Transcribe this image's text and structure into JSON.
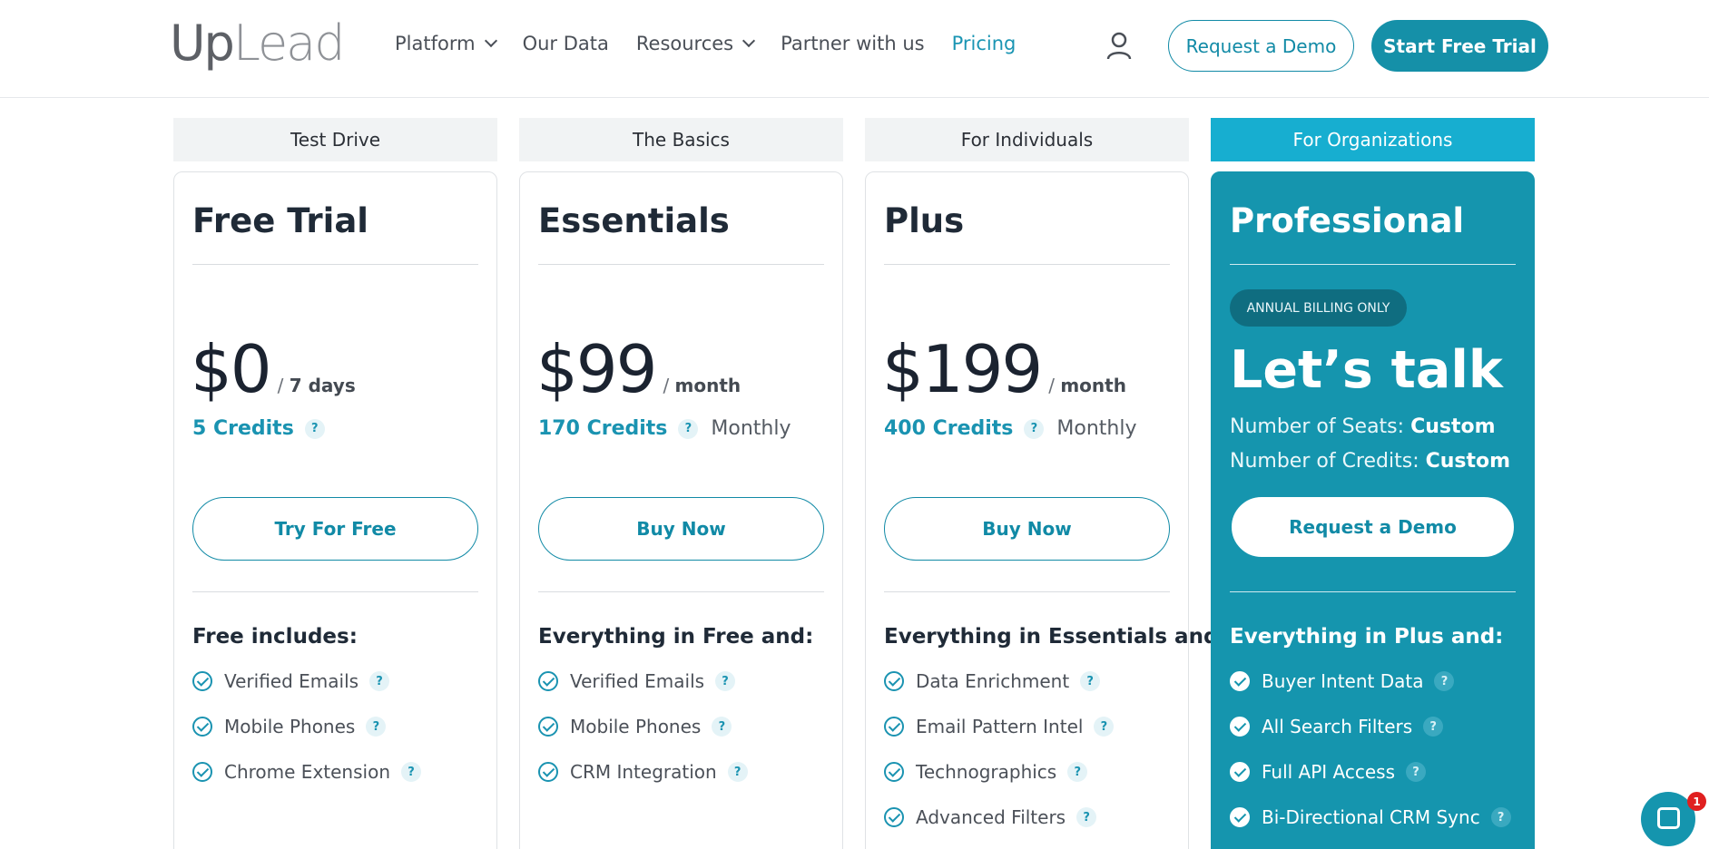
{
  "header": {
    "logo": {
      "part1": "Up",
      "part2": "Lead"
    },
    "nav": [
      {
        "label": "Platform",
        "dropdown": true
      },
      {
        "label": "Our Data",
        "dropdown": false
      },
      {
        "label": "Resources",
        "dropdown": true
      },
      {
        "label": "Partner with us",
        "dropdown": false
      },
      {
        "label": "Pricing",
        "dropdown": false,
        "active": true
      }
    ],
    "user_icon": "user-icon",
    "request_demo_label": "Request a Demo",
    "start_trial_label": "Start Free Trial"
  },
  "tiers": [
    "Test Drive",
    "The Basics",
    "For Individuals",
    "For Organizations"
  ],
  "plans": [
    {
      "title": "Free Trial",
      "price": "$0",
      "per": "/",
      "period": "7 days",
      "credits": "5 Credits",
      "credits_period": "",
      "button": "Try For Free",
      "includes": "Free includes:",
      "features": [
        "Verified Emails",
        "Mobile Phones",
        "Chrome Extension"
      ]
    },
    {
      "title": "Essentials",
      "price": "$99",
      "per": "/",
      "period": "month",
      "credits": "170 Credits",
      "credits_period": "Monthly",
      "button": "Buy Now",
      "includes": "Everything in Free and:",
      "features": [
        "Verified Emails",
        "Mobile Phones",
        "CRM Integration"
      ]
    },
    {
      "title": "Plus",
      "price": "$199",
      "per": "/",
      "period": "month",
      "credits": "400 Credits",
      "credits_period": "Monthly",
      "button": "Buy Now",
      "includes": "Everything in Essentials and:",
      "features": [
        "Data Enrichment",
        "Email Pattern Intel",
        "Technographics",
        "Advanced Filters"
      ]
    },
    {
      "title": "Professional",
      "badge": "ANNUAL BILLING ONLY",
      "headline": "Let’s talk",
      "seats_label": "Number of Seats:",
      "seats_value": "Custom",
      "credits_label": "Number of Credits:",
      "credits_value": "Custom",
      "button": "Request a Demo",
      "includes": "Everything in Plus and:",
      "features": [
        "Buyer Intent Data",
        "All Search Filters",
        "Full API Access",
        "Bi-Directional CRM Sync"
      ]
    }
  ],
  "help_glyph": "?",
  "chat": {
    "badge_count": "1"
  },
  "colors": {
    "accent": "#1590a8",
    "tab_highlight": "#17aed0",
    "pro_card": "#1595ae"
  }
}
